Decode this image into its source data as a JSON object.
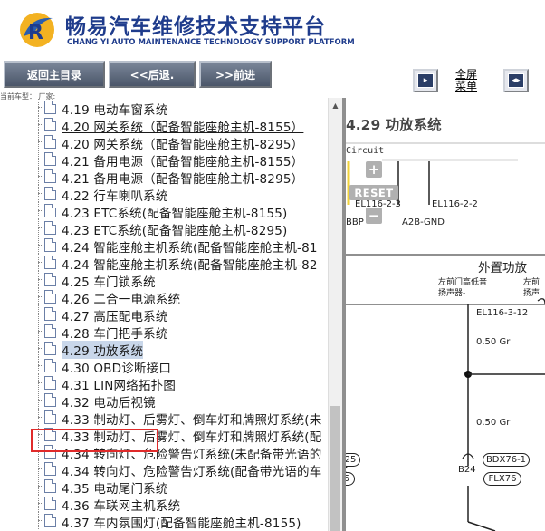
{
  "header": {
    "title_cn": "畅易汽车维修技术支持平台",
    "title_en": "CHANG YI AUTO MAINTENANCE TECHNOLOGY SUPPORT PLATFORM",
    "logo_icon": "cy-logo-icon"
  },
  "toolbar": {
    "home_label": "返回主目录",
    "back_label": "<<后退.",
    "forward_label": ">>前进",
    "fullscreen_label_1": "全屏",
    "fullscreen_label_2": "菜单"
  },
  "left": {
    "car_type": "当前车型：   厂家:",
    "items": [
      {
        "label": "4.19 电动车窗系统"
      },
      {
        "label": "4.20 网关系统（配备智能座舱主机-8155）"
      },
      {
        "label": "4.20 网关系统（配备智能座舱主机-8295）"
      },
      {
        "label": "4.21 备用电源（配备智能座舱主机-8155）"
      },
      {
        "label": "4.21 备用电源（配备智能座舱主机-8295）"
      },
      {
        "label": "4.22 行车喇叭系统"
      },
      {
        "label": "4.23 ETC系统(配备智能座舱主机-8155)"
      },
      {
        "label": "4.23 ETC系统(配备智能座舱主机-8295)"
      },
      {
        "label": "4.24 智能座舱主机系统(配备智能座舱主机-81"
      },
      {
        "label": "4.24 智能座舱主机系统(配备智能座舱主机-82"
      },
      {
        "label": "4.25 车门锁系统"
      },
      {
        "label": "4.26 二合一电源系统"
      },
      {
        "label": "4.27 高压配电系统"
      },
      {
        "label": "4.28 车门把手系统"
      },
      {
        "label": "4.29 功放系统"
      },
      {
        "label": "4.30 OBD诊断接口"
      },
      {
        "label": "4.31 LIN网络拓扑图"
      },
      {
        "label": "4.32 电动后视镜"
      },
      {
        "label": "4.33 制动灯、后雾灯、倒车灯和牌照灯系统(未"
      },
      {
        "label": "4.33 制动灯、后雾灯、倒车灯和牌照灯系统(配"
      },
      {
        "label": "4.34 转向灯、危险警告灯系统(未配备带光语的"
      },
      {
        "label": "4.34 转向灯、危险警告灯系统(配备带光语的车"
      },
      {
        "label": "4.35 电动尾门系统"
      },
      {
        "label": "4.36 车联网主机系统"
      },
      {
        "label": "4.37 车内氛围灯(配备智能座舱主机-8155)"
      }
    ]
  },
  "right": {
    "title": "4.29 功放系统",
    "circuit": "Circuit",
    "reset": "RESET",
    "el1": "EL116-2-3",
    "el2": "EL116-2-2",
    "bbp": "BBP",
    "a2b": "A2B-GND",
    "section": "外置功放",
    "spk1a": "左前门高低音",
    "spk1b": "扬声器-",
    "spk2a": "左前",
    "spk2b": "扬声",
    "el3": "EL116-3-12",
    "wire1": "0.50 Gr",
    "wire2": "0.50 Gr",
    "b24": "B24",
    "pill1": "BDX76-1",
    "pill2": "FLX76",
    "pill3": "25",
    "pill4": "5"
  }
}
